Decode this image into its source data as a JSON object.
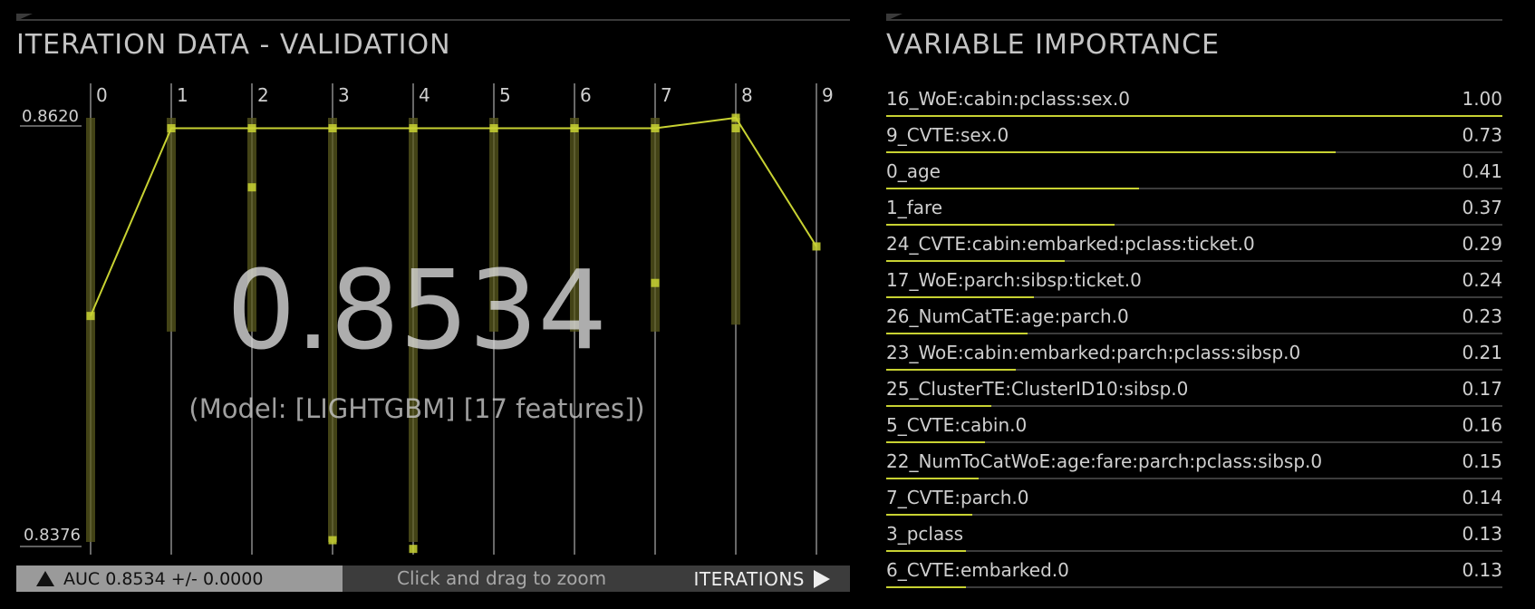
{
  "left_panel": {
    "title": "ITERATION DATA - VALIDATION",
    "big_score": "0.8534",
    "model_label": "(Model: [LIGHTGBM] [17 features])",
    "footer": {
      "metric": "AUC 0.8534 +/- 0.0000",
      "hint": "Click and drag to zoom",
      "iterations_label": "ITERATIONS"
    }
  },
  "colors": {
    "accent": "#c8d232",
    "band": "#5a5a1e",
    "text": "#c8c8c8",
    "footer_left_bg": "#9a9a9a",
    "footer_bg": "#3c3c3c"
  },
  "chart_data": {
    "type": "line",
    "x": [
      0,
      1,
      2,
      3,
      4,
      5,
      6,
      7,
      8,
      9
    ],
    "xlabel": "ITERATIONS",
    "ylim": [
      0.8376,
      0.862
    ],
    "ytick_labels": [
      "0.8620",
      "0.8376"
    ],
    "series": [
      {
        "values": [
          0.8506,
          0.8614,
          0.8614,
          0.8614,
          0.8614,
          0.8614,
          0.8614,
          0.8614,
          0.862,
          0.8546
        ]
      }
    ],
    "ranges": [
      [
        0.8376,
        0.862
      ],
      [
        0.8497,
        0.862
      ],
      [
        0.8497,
        0.862
      ],
      [
        0.8376,
        0.862
      ],
      [
        0.8376,
        0.862
      ],
      [
        0.8497,
        0.862
      ],
      [
        0.8497,
        0.862
      ],
      [
        0.8497,
        0.862
      ],
      [
        0.8501,
        0.862
      ],
      null
    ],
    "points": [
      [
        [
          0.8506
        ]
      ],
      [
        [
          0.8614
        ]
      ],
      [
        [
          0.8614
        ],
        [
          0.858
        ]
      ],
      [
        [
          0.8614
        ],
        [
          0.8377
        ]
      ],
      [
        [
          0.8614
        ],
        [
          0.8372
        ]
      ],
      [
        [
          0.8614
        ]
      ],
      [
        [
          0.8614
        ]
      ],
      [
        [
          0.8614
        ],
        [
          0.8525
        ]
      ],
      [
        [
          0.862
        ],
        [
          0.8614
        ]
      ],
      [
        [
          0.8546
        ]
      ]
    ]
  },
  "variable_importance": {
    "title": "VARIABLE IMPORTANCE",
    "items": [
      {
        "name": "16_WoE:cabin:pclass:sex.0",
        "value": "1.00",
        "score": 1.0
      },
      {
        "name": "9_CVTE:sex.0",
        "value": "0.73",
        "score": 0.73
      },
      {
        "name": "0_age",
        "value": "0.41",
        "score": 0.41
      },
      {
        "name": "1_fare",
        "value": "0.37",
        "score": 0.37
      },
      {
        "name": "24_CVTE:cabin:embarked:pclass:ticket.0",
        "value": "0.29",
        "score": 0.29
      },
      {
        "name": "17_WoE:parch:sibsp:ticket.0",
        "value": "0.24",
        "score": 0.24
      },
      {
        "name": "26_NumCatTE:age:parch.0",
        "value": "0.23",
        "score": 0.23
      },
      {
        "name": "23_WoE:cabin:embarked:parch:pclass:sibsp.0",
        "value": "0.21",
        "score": 0.21
      },
      {
        "name": "25_ClusterTE:ClusterID10:sibsp.0",
        "value": "0.17",
        "score": 0.17
      },
      {
        "name": "5_CVTE:cabin.0",
        "value": "0.16",
        "score": 0.16
      },
      {
        "name": "22_NumToCatWoE:age:fare:parch:pclass:sibsp.0",
        "value": "0.15",
        "score": 0.15
      },
      {
        "name": "7_CVTE:parch.0",
        "value": "0.14",
        "score": 0.14
      },
      {
        "name": "3_pclass",
        "value": "0.13",
        "score": 0.13
      },
      {
        "name": "6_CVTE:embarked.0",
        "value": "0.13",
        "score": 0.13
      }
    ]
  }
}
